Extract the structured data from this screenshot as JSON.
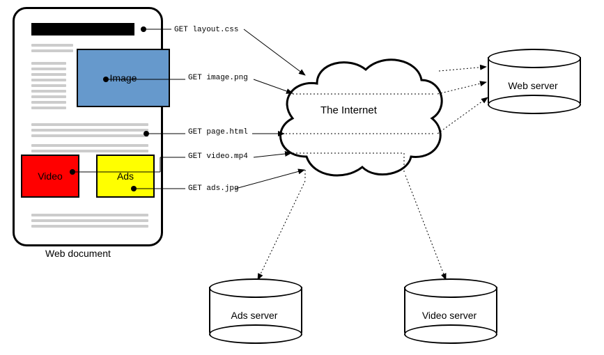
{
  "document": {
    "caption": "Web document",
    "image_label": "Image",
    "video_label": "Video",
    "ads_label": "Ads"
  },
  "cloud": {
    "label": "The Internet"
  },
  "servers": {
    "web": "Web server",
    "ads": "Ads server",
    "video": "Video server"
  },
  "requests": {
    "layout": "GET layout.css",
    "image": "GET image.png",
    "page": "GET page.html",
    "video": "GET video.mp4",
    "ads": "GET ads.jpg"
  }
}
